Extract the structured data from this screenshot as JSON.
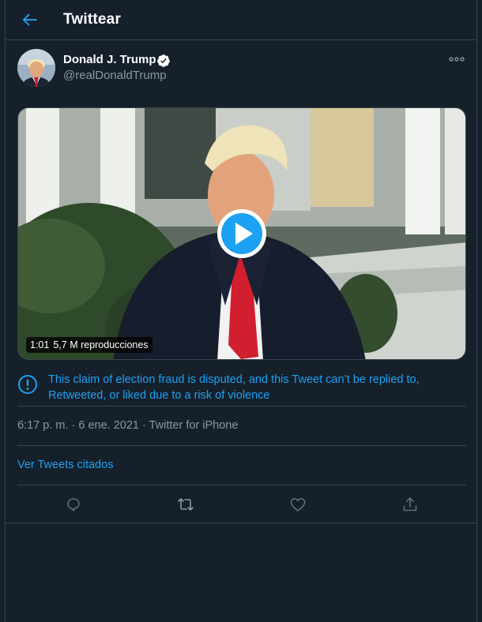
{
  "header": {
    "title": "Twittear",
    "back_icon": "arrow-left-icon"
  },
  "tweet": {
    "author_name": "Donald J. Trump",
    "author_handle": "@realDonaldTrump",
    "verified_icon": "verified-badge-icon",
    "more_icon": "more-horizontal-icon",
    "video": {
      "duration": "1:01",
      "views": "5,7 M reproducciones",
      "play_icon": "play-icon"
    },
    "notice": {
      "icon": "exclamation-circle-icon",
      "text": "This claim of election fraud is disputed, and this Tweet can’t be replied to, Retweeted, or liked due to a risk of violence"
    },
    "timestamp": "6:17 p. m. · 6 ene. 2021 · Twitter for iPhone",
    "quoted_link": "Ver Tweets citados",
    "actions": [
      "reply-icon",
      "retweet-icon",
      "like-icon",
      "share-icon"
    ]
  },
  "colors": {
    "background": "#15202b",
    "border": "#38444d",
    "accent": "#1da1f2",
    "muted": "#8899a6"
  }
}
